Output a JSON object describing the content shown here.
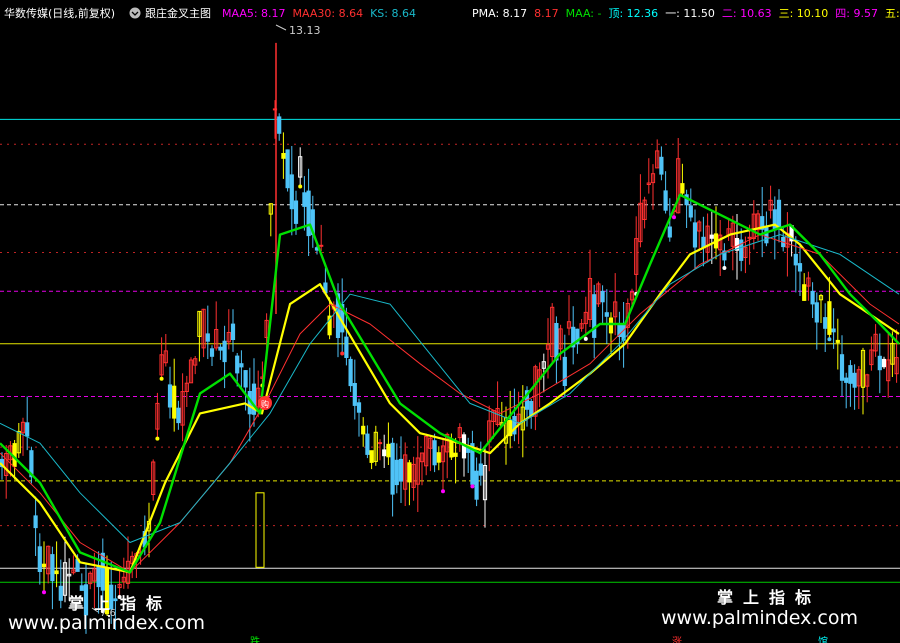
{
  "header": {
    "stock": "华数传媒(日线,前复权)",
    "circle_icon": "circle-dropdown-icon",
    "indicator": "跟庄金叉主图",
    "items": [
      {
        "label": "MAA5: 8.17",
        "color": "#ff00ff"
      },
      {
        "label": "MAA30: 8.64",
        "color": "#ff3030"
      },
      {
        "label": "KS: 8.64",
        "color": "#19b8c9"
      }
    ],
    "right_items": [
      {
        "label": "PMA: 8.17",
        "color": "#ffffff"
      },
      {
        "label": "8.17",
        "color": "#ff3030"
      },
      {
        "label": "MAA: -",
        "color": "#00e000"
      },
      {
        "label": "顶: 12.36",
        "color": "#00ffff"
      },
      {
        "label": "一: 11.50",
        "color": "#ffffff"
      },
      {
        "label": "二: 10.63",
        "color": "#ff00ff"
      },
      {
        "label": "三: 10.10",
        "color": "#ffff00"
      },
      {
        "label": "四: 9.57",
        "color": "#ff00ff"
      },
      {
        "label": "五:",
        "color": "#ffff00"
      }
    ]
  },
  "annotations": {
    "high_label": "13.13",
    "low_label": "7.6",
    "buy_mark": "购",
    "bottom_left_mark": "跌",
    "bottom_mid_mark": "涨",
    "bottom_right_mark": "馆"
  },
  "watermark": {
    "cn_left": "掌上指标",
    "url_left": "www.palmindex.com",
    "cn_right": "掌上指标",
    "url_right": "www.palmindex.com"
  },
  "chart_data": {
    "type": "candlestick",
    "title": "华数传媒(日线,前复权)",
    "ylim": [
      7.4,
      13.3
    ],
    "levels": [
      {
        "name": "顶",
        "value": 12.36,
        "color": "#00ffff",
        "style": "solid"
      },
      {
        "name": "一",
        "value": 11.5,
        "color": "#ffffff",
        "style": "dashed"
      },
      {
        "name": "二",
        "value": 10.63,
        "color": "#ff00ff",
        "style": "dashed"
      },
      {
        "name": "三",
        "value": 10.1,
        "color": "#ffff00",
        "style": "solid"
      },
      {
        "name": "四",
        "value": 9.57,
        "color": "#ff00ff",
        "style": "dashed"
      },
      {
        "name": "五",
        "value": 8.72,
        "color": "#ffff00",
        "style": "dashed"
      },
      {
        "name": "",
        "value": 7.84,
        "color": "#ffffff",
        "style": "solid"
      },
      {
        "name": "",
        "value": 7.7,
        "color": "#00e000",
        "style": "solid"
      }
    ],
    "extra_levels": [
      {
        "value": 12.11,
        "color": "#ff3030"
      },
      {
        "value": 11.02,
        "color": "#ff3030"
      },
      {
        "value": 9.06,
        "color": "#ff3030"
      },
      {
        "value": 8.27,
        "color": "#ff3030"
      }
    ],
    "price_path": [
      [
        0,
        8.9
      ],
      [
        5,
        8.8
      ],
      [
        10,
        9.1
      ],
      [
        15,
        9.0
      ],
      [
        20,
        9.2
      ],
      [
        25,
        9.3
      ],
      [
        30,
        9.1
      ],
      [
        35,
        8.4
      ],
      [
        40,
        8.0
      ],
      [
        45,
        7.9
      ],
      [
        50,
        7.95
      ],
      [
        55,
        7.8
      ],
      [
        60,
        7.7
      ],
      [
        65,
        7.75
      ],
      [
        70,
        7.8
      ],
      [
        75,
        7.9
      ],
      [
        80,
        7.75
      ],
      [
        85,
        7.65
      ],
      [
        90,
        7.7
      ],
      [
        95,
        7.8
      ],
      [
        100,
        7.75
      ],
      [
        105,
        7.7
      ],
      [
        110,
        7.65
      ],
      [
        115,
        7.6
      ],
      [
        120,
        7.7
      ],
      [
        125,
        7.75
      ],
      [
        130,
        7.8
      ],
      [
        135,
        7.9
      ],
      [
        140,
        8.1
      ],
      [
        145,
        8.0
      ],
      [
        150,
        8.3
      ],
      [
        155,
        8.9
      ],
      [
        160,
        9.7
      ],
      [
        165,
        10.1
      ],
      [
        170,
        9.6
      ],
      [
        175,
        9.5
      ],
      [
        180,
        9.3
      ],
      [
        185,
        9.6
      ],
      [
        190,
        9.8
      ],
      [
        195,
        9.9
      ],
      [
        200,
        10.2
      ],
      [
        205,
        10.4
      ],
      [
        210,
        10.0
      ],
      [
        215,
        10.2
      ],
      [
        220,
        10.1
      ],
      [
        225,
        10.0
      ],
      [
        230,
        10.2
      ],
      [
        235,
        10.1
      ],
      [
        240,
        9.9
      ],
      [
        245,
        9.8
      ],
      [
        250,
        9.7
      ],
      [
        255,
        9.5
      ],
      [
        260,
        9.6
      ],
      [
        265,
        9.9
      ],
      [
        270,
        11.3
      ],
      [
        275,
        12.5
      ],
      [
        280,
        12.3
      ],
      [
        285,
        12.0
      ],
      [
        290,
        11.8
      ],
      [
        295,
        11.5
      ],
      [
        300,
        11.7
      ],
      [
        305,
        11.6
      ],
      [
        310,
        11.4
      ],
      [
        315,
        11.0
      ],
      [
        320,
        11.2
      ],
      [
        325,
        10.7
      ],
      [
        330,
        10.3
      ],
      [
        335,
        10.5
      ],
      [
        340,
        10.4
      ],
      [
        345,
        10.2
      ],
      [
        350,
        9.9
      ],
      [
        355,
        9.6
      ],
      [
        360,
        9.4
      ],
      [
        365,
        9.1
      ],
      [
        370,
        9.0
      ],
      [
        375,
        9.1
      ],
      [
        380,
        9.2
      ],
      [
        385,
        9.0
      ],
      [
        390,
        8.9
      ],
      [
        395,
        8.95
      ],
      [
        400,
        8.85
      ],
      [
        405,
        8.9
      ],
      [
        410,
        8.8
      ],
      [
        415,
        8.85
      ],
      [
        420,
        8.95
      ],
      [
        425,
        9.0
      ],
      [
        430,
        9.1
      ],
      [
        435,
        9.0
      ],
      [
        440,
        8.95
      ],
      [
        445,
        9.1
      ],
      [
        450,
        9.15
      ],
      [
        455,
        9.0
      ],
      [
        460,
        9.2
      ],
      [
        465,
        9.1
      ],
      [
        470,
        9.0
      ],
      [
        475,
        8.8
      ],
      [
        480,
        8.75
      ],
      [
        485,
        8.8
      ],
      [
        490,
        9.2
      ],
      [
        495,
        9.3
      ],
      [
        500,
        9.35
      ],
      [
        505,
        9.4
      ],
      [
        510,
        9.35
      ],
      [
        515,
        9.3
      ],
      [
        520,
        9.45
      ],
      [
        525,
        9.5
      ],
      [
        530,
        9.4
      ],
      [
        535,
        9.6
      ],
      [
        540,
        9.9
      ],
      [
        545,
        10.0
      ],
      [
        550,
        10.3
      ],
      [
        555,
        10.1
      ],
      [
        560,
        10.2
      ],
      [
        565,
        10.0
      ],
      [
        570,
        10.3
      ],
      [
        575,
        10.1
      ],
      [
        580,
        10.2
      ],
      [
        585,
        10.4
      ],
      [
        590,
        10.6
      ],
      [
        595,
        10.5
      ],
      [
        600,
        10.7
      ],
      [
        605,
        10.5
      ],
      [
        610,
        10.3
      ],
      [
        615,
        10.5
      ],
      [
        620,
        10.4
      ],
      [
        625,
        10.2
      ],
      [
        630,
        10.6
      ],
      [
        635,
        10.9
      ],
      [
        640,
        11.3
      ],
      [
        645,
        11.5
      ],
      [
        650,
        11.7
      ],
      [
        655,
        11.9
      ],
      [
        660,
        12.0
      ],
      [
        665,
        11.6
      ],
      [
        670,
        11.3
      ],
      [
        675,
        11.5
      ],
      [
        680,
        11.9
      ],
      [
        685,
        11.6
      ],
      [
        690,
        11.4
      ],
      [
        695,
        11.2
      ],
      [
        700,
        11.3
      ],
      [
        705,
        11.2
      ],
      [
        710,
        11.3
      ],
      [
        715,
        11.1
      ],
      [
        720,
        11.2
      ],
      [
        725,
        11.0
      ],
      [
        730,
        11.3
      ],
      [
        735,
        11.2
      ],
      [
        740,
        11.0
      ],
      [
        745,
        11.1
      ],
      [
        750,
        11.2
      ],
      [
        755,
        11.3
      ],
      [
        760,
        11.4
      ],
      [
        765,
        11.2
      ],
      [
        770,
        11.5
      ],
      [
        775,
        11.4
      ],
      [
        780,
        11.3
      ],
      [
        785,
        11.2
      ],
      [
        790,
        11.3
      ],
      [
        795,
        11.1
      ],
      [
        800,
        10.9
      ],
      [
        805,
        10.6
      ],
      [
        810,
        10.7
      ],
      [
        815,
        10.5
      ],
      [
        820,
        10.6
      ],
      [
        825,
        10.4
      ],
      [
        830,
        10.3
      ],
      [
        835,
        10.2
      ],
      [
        840,
        10.0
      ],
      [
        845,
        9.8
      ],
      [
        850,
        9.7
      ],
      [
        855,
        9.6
      ],
      [
        860,
        9.75
      ],
      [
        865,
        9.8
      ],
      [
        870,
        9.9
      ],
      [
        875,
        10.0
      ],
      [
        880,
        9.9
      ],
      [
        885,
        9.85
      ],
      [
        890,
        9.9
      ],
      [
        895,
        9.95
      ],
      [
        899,
        9.9
      ]
    ],
    "series": [
      {
        "name": "MAA5",
        "color": "#ffff00",
        "values": [
          [
            0,
            8.9
          ],
          [
            40,
            8.5
          ],
          [
            80,
            7.9
          ],
          [
            130,
            7.8
          ],
          [
            165,
            8.7
          ],
          [
            200,
            9.4
          ],
          [
            245,
            9.5
          ],
          [
            262,
            9.4
          ],
          [
            290,
            10.5
          ],
          [
            320,
            10.7
          ],
          [
            355,
            10.1
          ],
          [
            390,
            9.5
          ],
          [
            420,
            9.2
          ],
          [
            460,
            9.1
          ],
          [
            490,
            9.0
          ],
          [
            520,
            9.3
          ],
          [
            550,
            9.5
          ],
          [
            590,
            9.8
          ],
          [
            625,
            10.1
          ],
          [
            660,
            10.6
          ],
          [
            690,
            11.0
          ],
          [
            730,
            11.2
          ],
          [
            775,
            11.3
          ],
          [
            800,
            11.1
          ],
          [
            840,
            10.6
          ],
          [
            899,
            10.2
          ]
        ]
      },
      {
        "name": "MAA30",
        "color": "#ff3030",
        "values": [
          [
            0,
            9.0
          ],
          [
            40,
            8.6
          ],
          [
            80,
            8.1
          ],
          [
            130,
            7.8
          ],
          [
            180,
            8.3
          ],
          [
            230,
            8.9
          ],
          [
            270,
            9.6
          ],
          [
            300,
            10.2
          ],
          [
            330,
            10.5
          ],
          [
            370,
            10.3
          ],
          [
            420,
            9.9
          ],
          [
            460,
            9.6
          ],
          [
            500,
            9.4
          ],
          [
            540,
            9.6
          ],
          [
            590,
            9.9
          ],
          [
            640,
            10.4
          ],
          [
            700,
            10.9
          ],
          [
            760,
            11.2
          ],
          [
            820,
            11.0
          ],
          [
            870,
            10.5
          ],
          [
            899,
            10.3
          ]
        ]
      },
      {
        "name": "KS",
        "color": "#19b8c9",
        "values": [
          [
            0,
            9.3
          ],
          [
            40,
            9.1
          ],
          [
            80,
            8.6
          ],
          [
            130,
            8.1
          ],
          [
            180,
            8.3
          ],
          [
            230,
            8.9
          ],
          [
            270,
            9.4
          ],
          [
            310,
            10.1
          ],
          [
            350,
            10.6
          ],
          [
            390,
            10.5
          ],
          [
            430,
            10.0
          ],
          [
            470,
            9.5
          ],
          [
            520,
            9.3
          ],
          [
            570,
            9.6
          ],
          [
            620,
            10.1
          ],
          [
            670,
            10.7
          ],
          [
            720,
            11.0
          ],
          [
            780,
            11.2
          ],
          [
            840,
            11.0
          ],
          [
            899,
            10.6
          ]
        ]
      },
      {
        "name": "MAA",
        "color": "#00e000",
        "values": [
          [
            0,
            9.1
          ],
          [
            40,
            8.7
          ],
          [
            80,
            8.0
          ],
          [
            130,
            7.8
          ],
          [
            160,
            8.3
          ],
          [
            200,
            9.6
          ],
          [
            230,
            9.8
          ],
          [
            260,
            9.4
          ],
          [
            280,
            11.2
          ],
          [
            310,
            11.3
          ],
          [
            340,
            10.5
          ],
          [
            370,
            10.0
          ],
          [
            400,
            9.5
          ],
          [
            440,
            9.2
          ],
          [
            480,
            9.0
          ],
          [
            520,
            9.5
          ],
          [
            560,
            10.0
          ],
          [
            600,
            10.3
          ],
          [
            625,
            10.3
          ],
          [
            650,
            10.9
          ],
          [
            680,
            11.6
          ],
          [
            720,
            11.4
          ],
          [
            760,
            11.2
          ],
          [
            790,
            11.3
          ],
          [
            820,
            11.0
          ],
          [
            850,
            10.6
          ],
          [
            880,
            10.3
          ],
          [
            899,
            10.1
          ]
        ]
      }
    ]
  }
}
